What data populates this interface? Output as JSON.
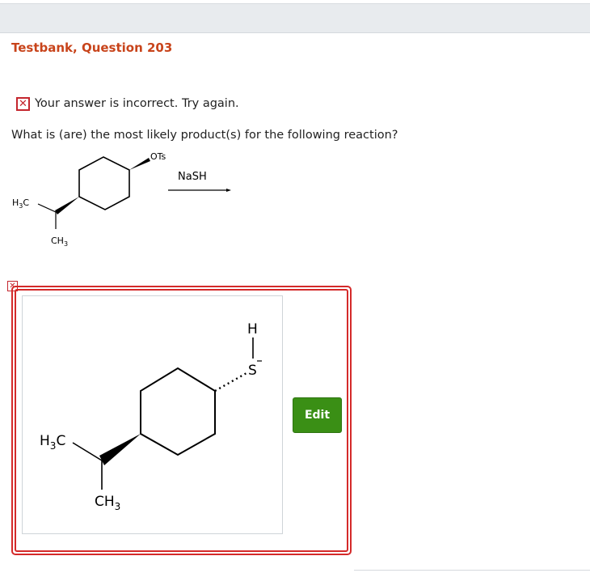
{
  "header": {
    "title": "Testbank, Question 203"
  },
  "feedback": {
    "status_icon": "x-mark",
    "status_color": "#c4262e",
    "text": "Your answer is incorrect.  Try again."
  },
  "question": {
    "prompt": "What is (are) the most likely product(s) for the following reaction?"
  },
  "reaction": {
    "reagent": "NaSH",
    "reactant_labels": {
      "leaving_group": "OTs",
      "methyl_left": "H3C",
      "methyl_down": "CH3"
    }
  },
  "answer": {
    "marker_icon": "x-mark",
    "edit_label": "Edit",
    "molecule_labels": {
      "thiol_s": "S",
      "thiol_h": "H",
      "methyl_left": "H3C",
      "methyl_down": "CH3"
    }
  },
  "colors": {
    "title": "#c8441b",
    "error": "#d42a2a",
    "edit_button": "#3a8f15"
  }
}
